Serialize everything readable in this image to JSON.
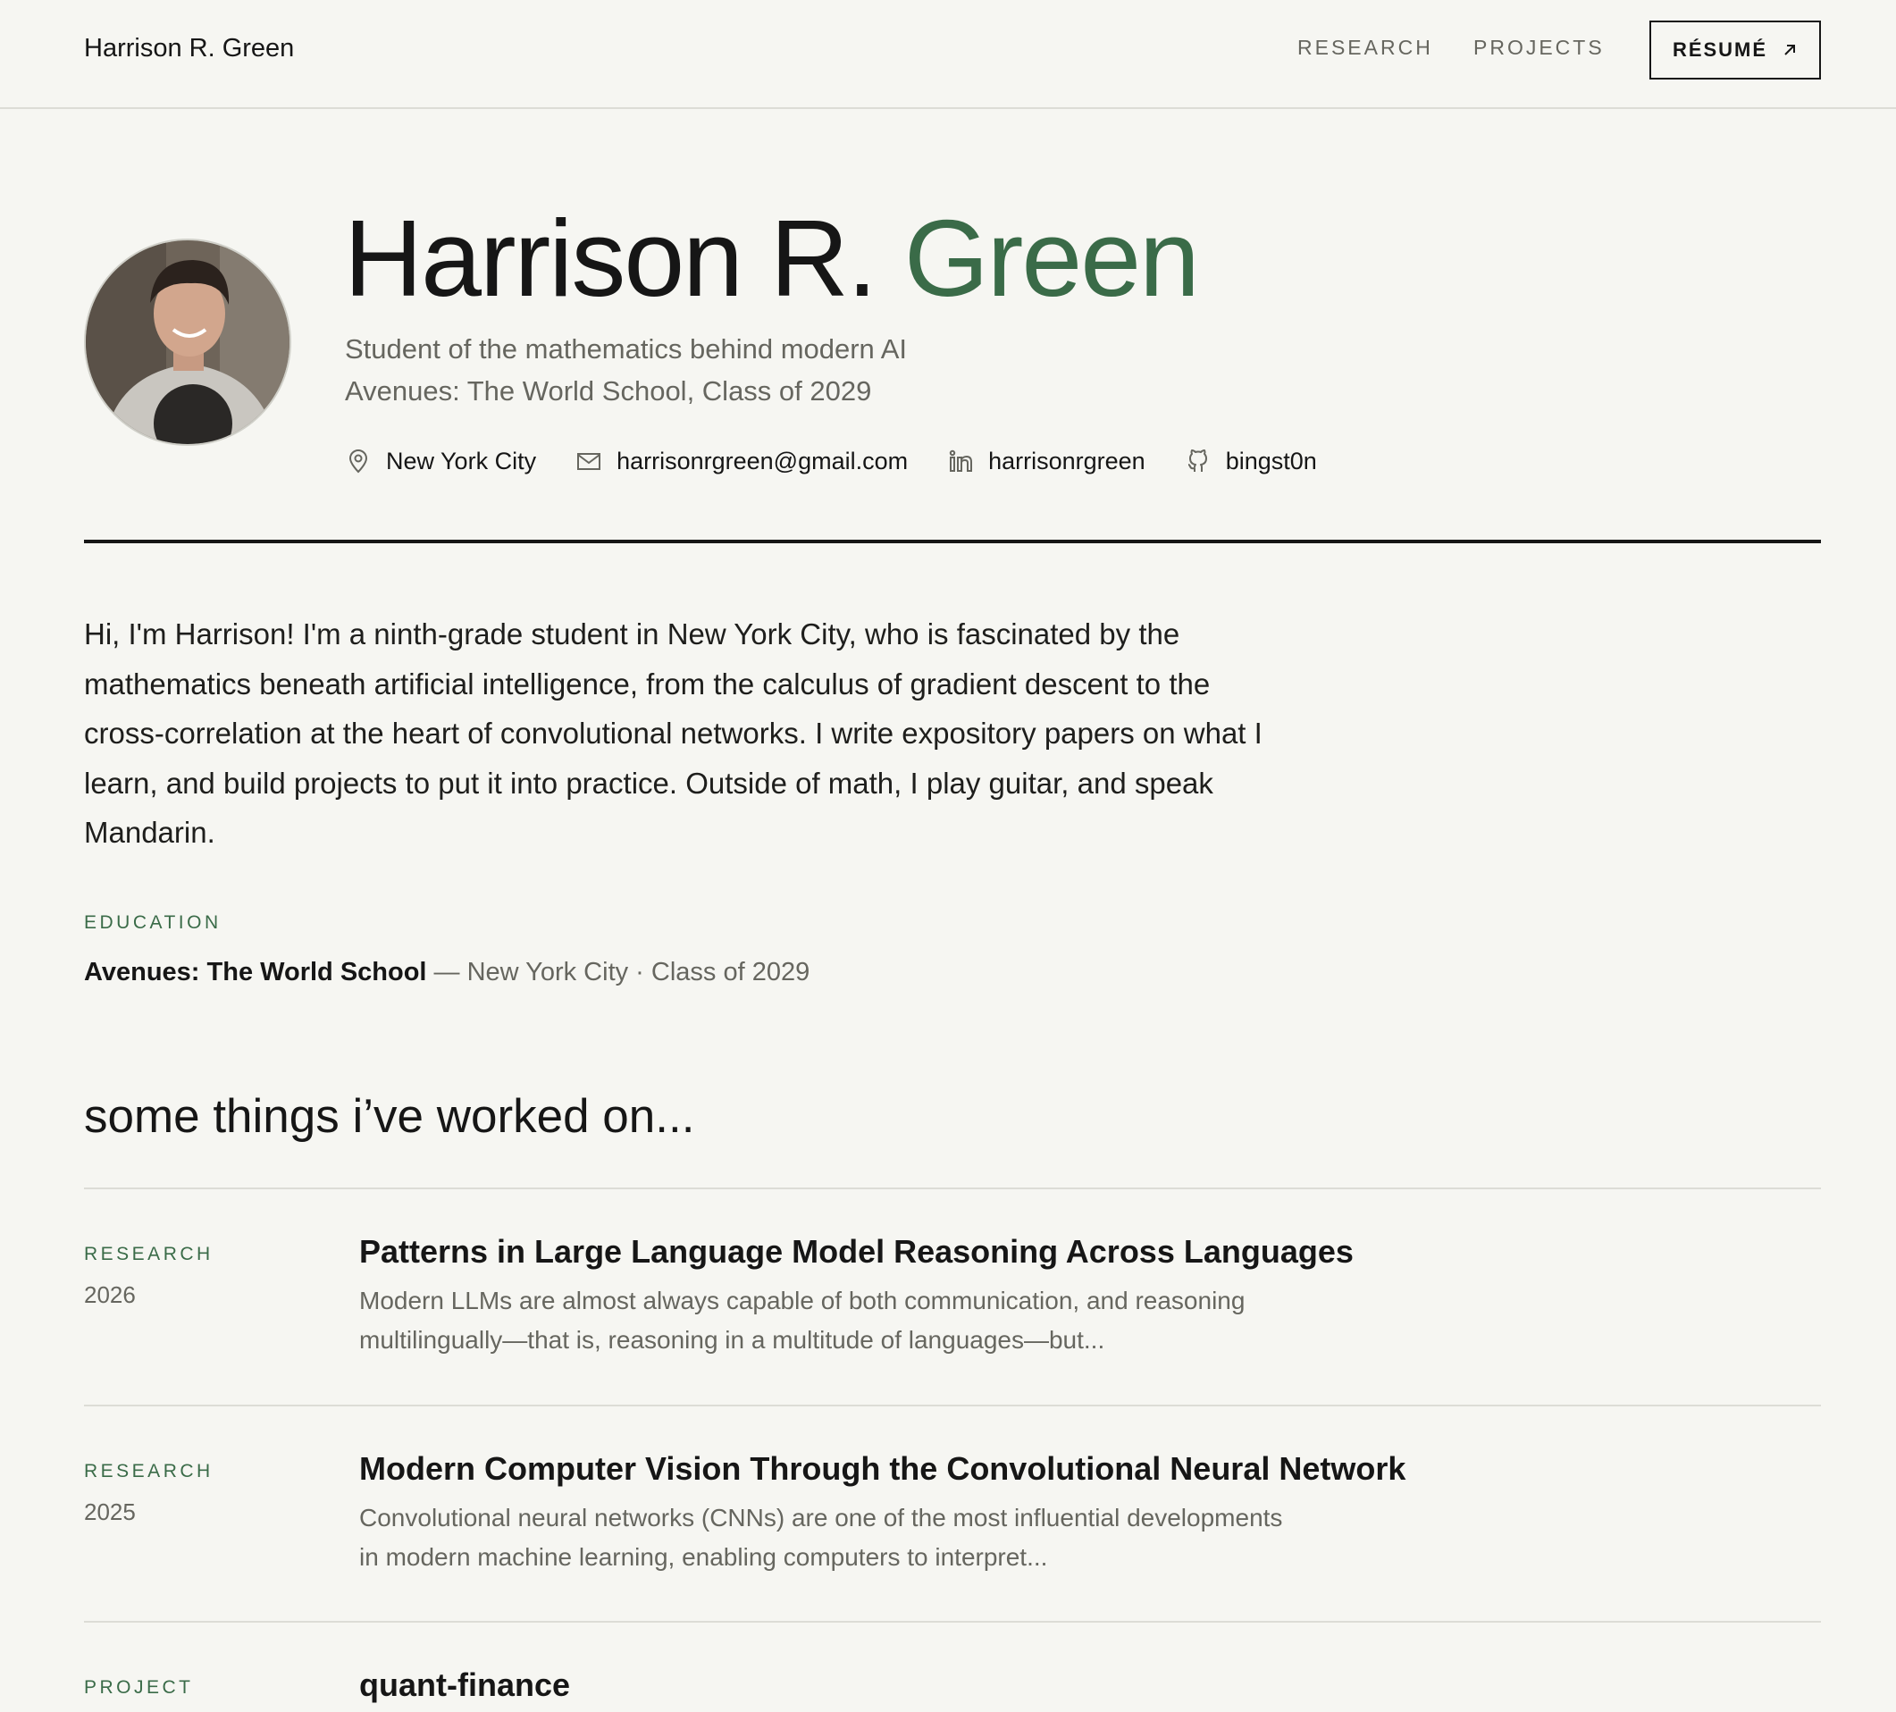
{
  "nav": {
    "brand": "Harrison R. Green",
    "links": [
      {
        "label": "RESEARCH"
      },
      {
        "label": "PROJECTS"
      }
    ],
    "resume_label": "RÉSUMÉ"
  },
  "hero": {
    "name_first": "Harrison R.",
    "name_last": "Green",
    "tagline": "Student of the mathematics behind modern AI",
    "school_line": "Avenues: The World School, Class of 2029",
    "contacts": {
      "location": {
        "icon": "map-pin-icon",
        "text": "New York City"
      },
      "email": {
        "icon": "mail-icon",
        "text": "harrisonrgreen@gmail.com"
      },
      "linkedin": {
        "icon": "linkedin-icon",
        "text": "harrisonrgreen"
      },
      "github": {
        "icon": "github-icon",
        "text": "bingst0n"
      }
    }
  },
  "bio": "Hi, I'm Harrison! I'm a ninth-grade student in New York City, who is fascinated by the mathematics beneath artificial intelligence, from the calculus of gradient descent to the cross-correlation at the heart of convolutional networks. I write expository papers on what I learn, and build projects to put it into practice. Outside of math, I play guitar, and speak Mandarin.",
  "education": {
    "label": "EDUCATION",
    "school": "Avenues: The World School",
    "detail": " — New York City · Class of 2029"
  },
  "work": {
    "heading": "some things i’ve worked on...",
    "items": [
      {
        "kind": "RESEARCH",
        "year": "2026",
        "title": "Patterns in Large Language Model Reasoning Across Languages",
        "desc": "Modern LLMs are almost always capable of both communication, and reasoning multilingually—that is, reasoning in a multitude of languages—but..."
      },
      {
        "kind": "RESEARCH",
        "year": "2025",
        "title": "Modern Computer Vision Through the Convolutional Neural Network",
        "desc": "Convolutional neural networks (CNNs) are one of the most influential developments in modern machine learning, enabling computers to interpret..."
      },
      {
        "kind": "PROJECT",
        "title": "quant-finance"
      }
    ]
  },
  "colors": {
    "accent": "#3a6b48",
    "background": "#f6f6f2",
    "text": "#161616",
    "muted": "#66665f"
  }
}
